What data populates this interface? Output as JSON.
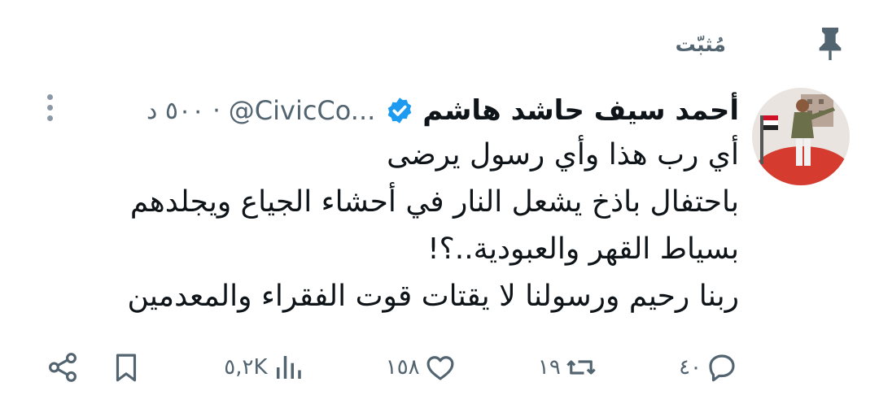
{
  "pinned": {
    "label": "مُثبّت",
    "icon": "pin-icon"
  },
  "tweet": {
    "author": {
      "display_name": "أحمد سيف حاشد هاشم",
      "handle": "@CivicCo...",
      "verified_icon": "verified-badge-icon",
      "avatar": "avatar"
    },
    "separator": "·",
    "time": "٥٠٠ د",
    "more_icon": "more-vertical-icon",
    "text_lines": [
      "أي رب هذا وأي رسول يرضى",
      "باحتفال باذخ يشعل النار في أحشاء الجياع ويجلدهم",
      "بسياط القهر والعبودية..؟!",
      "ربنا رحيم ورسولنا لا يقتات قوت الفقراء والمعدمين"
    ],
    "actions": {
      "reply": {
        "icon": "reply-icon",
        "count": "٤٠"
      },
      "retweet": {
        "icon": "retweet-icon",
        "count": "١٩"
      },
      "like": {
        "icon": "heart-icon",
        "count": "١٥٨"
      },
      "views": {
        "icon": "views-icon",
        "count": "٥,٢K"
      },
      "bookmark": {
        "icon": "bookmark-icon"
      },
      "share": {
        "icon": "share-icon"
      }
    }
  },
  "colors": {
    "text": "#0f1419",
    "secondary": "#536471",
    "verified": "#1d9bf0",
    "avatar_accent": "#d63b2f"
  }
}
